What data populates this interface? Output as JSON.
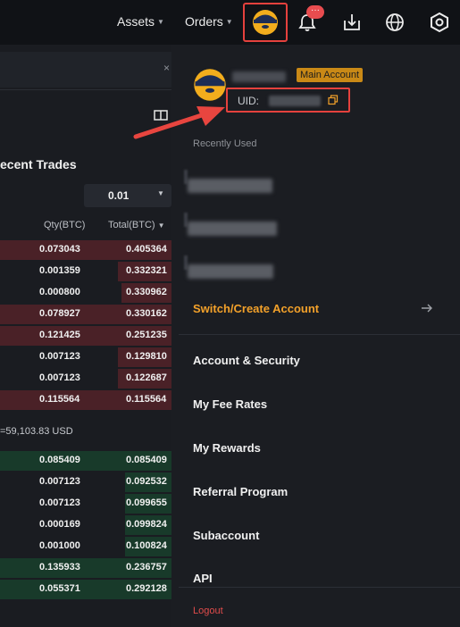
{
  "nav": {
    "assets_label": "Assets",
    "orders_label": "Orders",
    "notification_badge": "···"
  },
  "left_panel": {
    "close_glyph": "×",
    "recent_trades_title": "ecent Trades",
    "precision_value": "0.01",
    "columns": {
      "qty": "Qty(BTC)",
      "total": "Total(BTC)"
    },
    "sell_rows": [
      {
        "qty": "0.073043",
        "total": "0.405364"
      },
      {
        "qty": "0.001359",
        "total": "0.332321"
      },
      {
        "qty": "0.000800",
        "total": "0.330962"
      },
      {
        "qty": "0.078927",
        "total": "0.330162"
      },
      {
        "qty": "0.121425",
        "total": "0.251235"
      },
      {
        "qty": "0.007123",
        "total": "0.129810"
      },
      {
        "qty": "0.007123",
        "total": "0.122687"
      },
      {
        "qty": "0.115564",
        "total": "0.115564"
      }
    ],
    "mid_price": "=59,103.83 USD",
    "buy_rows": [
      {
        "qty": "0.085409",
        "total": "0.085409"
      },
      {
        "qty": "0.007123",
        "total": "0.092532"
      },
      {
        "qty": "0.007123",
        "total": "0.099655"
      },
      {
        "qty": "0.000169",
        "total": "0.099824"
      },
      {
        "qty": "0.001000",
        "total": "0.100824"
      },
      {
        "qty": "0.135933",
        "total": "0.236757"
      },
      {
        "qty": "0.055371",
        "total": "0.292128"
      }
    ]
  },
  "dropdown": {
    "main_account_badge": "Main Account",
    "uid_label": "UID:",
    "recently_used_label": "Recently Used",
    "switch_label": "Switch/Create Account",
    "menu": [
      {
        "label": "Account & Security"
      },
      {
        "label": "My Fee Rates"
      },
      {
        "label": "My Rewards"
      },
      {
        "label": "Referral Program"
      },
      {
        "label": "Subaccount"
      },
      {
        "label": "API"
      }
    ],
    "logout_label": "Logout"
  },
  "colors": {
    "accent": "#f3a12a",
    "highlight_red": "#e5413d",
    "sell_fill": "#4a2127",
    "buy_fill": "#183a2a"
  },
  "icons": [
    "chevron-down-icon",
    "avatar-icon",
    "bell-icon",
    "download-icon",
    "globe-icon",
    "settings-hex-icon",
    "close-icon",
    "orderbook-icon",
    "copy-icon",
    "arrow-right-icon"
  ]
}
